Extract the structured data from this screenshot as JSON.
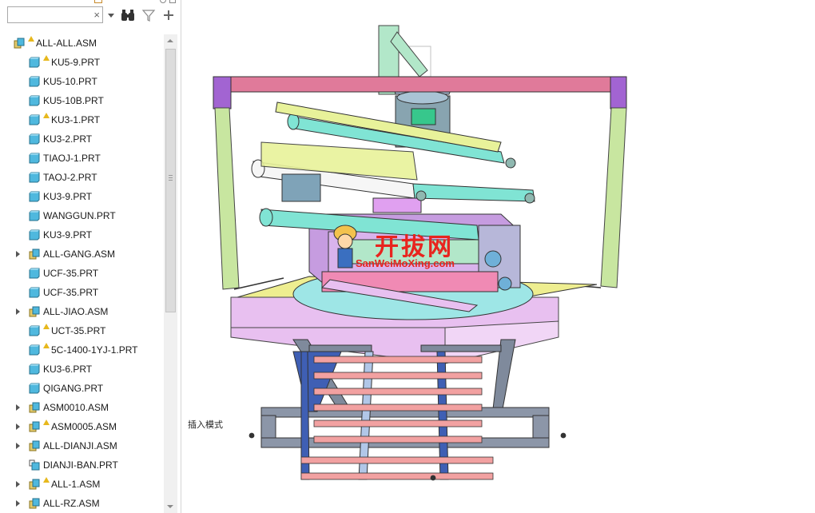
{
  "toolbar": {
    "search": {
      "value": "",
      "placeholder": ""
    },
    "clear_icon": "×",
    "find_icon": "binoculars-icon",
    "filter_icon": "filter-icon",
    "add_icon": "plus-icon"
  },
  "tree": {
    "items": [
      {
        "label": "ALL-ALL.ASM",
        "type": "asm",
        "warning": true,
        "expandable": false,
        "level": 0
      },
      {
        "label": "KU5-9.PRT",
        "type": "prt",
        "warning": true,
        "expandable": false,
        "level": 1
      },
      {
        "label": "KU5-10.PRT",
        "type": "prt",
        "warning": false,
        "expandable": false,
        "level": 1
      },
      {
        "label": "KU5-10B.PRT",
        "type": "prt",
        "warning": false,
        "expandable": false,
        "level": 1
      },
      {
        "label": "KU3-1.PRT",
        "type": "prt",
        "warning": true,
        "expandable": false,
        "level": 1
      },
      {
        "label": "KU3-2.PRT",
        "type": "prt",
        "warning": false,
        "expandable": false,
        "level": 1
      },
      {
        "label": "TIAOJ-1.PRT",
        "type": "prt",
        "warning": false,
        "expandable": false,
        "level": 1
      },
      {
        "label": "TAOJ-2.PRT",
        "type": "prt",
        "warning": false,
        "expandable": false,
        "level": 1
      },
      {
        "label": "KU3-9.PRT",
        "type": "prt",
        "warning": false,
        "expandable": false,
        "level": 1
      },
      {
        "label": "WANGGUN.PRT",
        "type": "prt",
        "warning": false,
        "expandable": false,
        "level": 1
      },
      {
        "label": "KU3-9.PRT",
        "type": "prt",
        "warning": false,
        "expandable": false,
        "level": 1
      },
      {
        "label": "ALL-GANG.ASM",
        "type": "asm",
        "warning": false,
        "expandable": true,
        "level": 1
      },
      {
        "label": "UCF-35.PRT",
        "type": "prt",
        "warning": false,
        "expandable": false,
        "level": 1
      },
      {
        "label": "UCF-35.PRT",
        "type": "prt",
        "warning": false,
        "expandable": false,
        "level": 1
      },
      {
        "label": "ALL-JIAO.ASM",
        "type": "asm",
        "warning": false,
        "expandable": true,
        "level": 1
      },
      {
        "label": "UCT-35.PRT",
        "type": "prt",
        "warning": true,
        "expandable": false,
        "level": 1
      },
      {
        "label": "5C-1400-1YJ-1.PRT",
        "type": "prt",
        "warning": true,
        "expandable": false,
        "level": 1
      },
      {
        "label": "KU3-6.PRT",
        "type": "prt",
        "warning": false,
        "expandable": false,
        "level": 1
      },
      {
        "label": "QIGANG.PRT",
        "type": "prt",
        "warning": false,
        "expandable": false,
        "level": 1
      },
      {
        "label": "ASM0010.ASM",
        "type": "asm",
        "warning": false,
        "expandable": true,
        "level": 1
      },
      {
        "label": "ASM0005.ASM",
        "type": "asm",
        "warning": true,
        "expandable": true,
        "level": 1
      },
      {
        "label": "ALL-DIANJI.ASM",
        "type": "asm",
        "warning": false,
        "expandable": true,
        "level": 1
      },
      {
        "label": "DIANJI-BAN.PRT",
        "type": "prt-link",
        "warning": false,
        "expandable": false,
        "level": 1
      },
      {
        "label": "ALL-1.ASM",
        "type": "asm",
        "warning": true,
        "expandable": true,
        "level": 1
      },
      {
        "label": "ALL-RZ.ASM",
        "type": "asm",
        "warning": false,
        "expandable": true,
        "level": 1
      }
    ]
  },
  "viewport": {
    "status_text": "插入模式",
    "watermark_title": "开拔网",
    "watermark_url": "SanWeiMoXing.com"
  },
  "colors": {
    "frame_pink": "#e07a9a",
    "frame_green": "#c8e6a0",
    "roller_cyan": "#7fe0d0",
    "platform_lilac": "#e8c0f0",
    "platform_yellow": "#eeee90",
    "base_gray": "#7f8a9c",
    "watermark_red": "#e8241e"
  }
}
